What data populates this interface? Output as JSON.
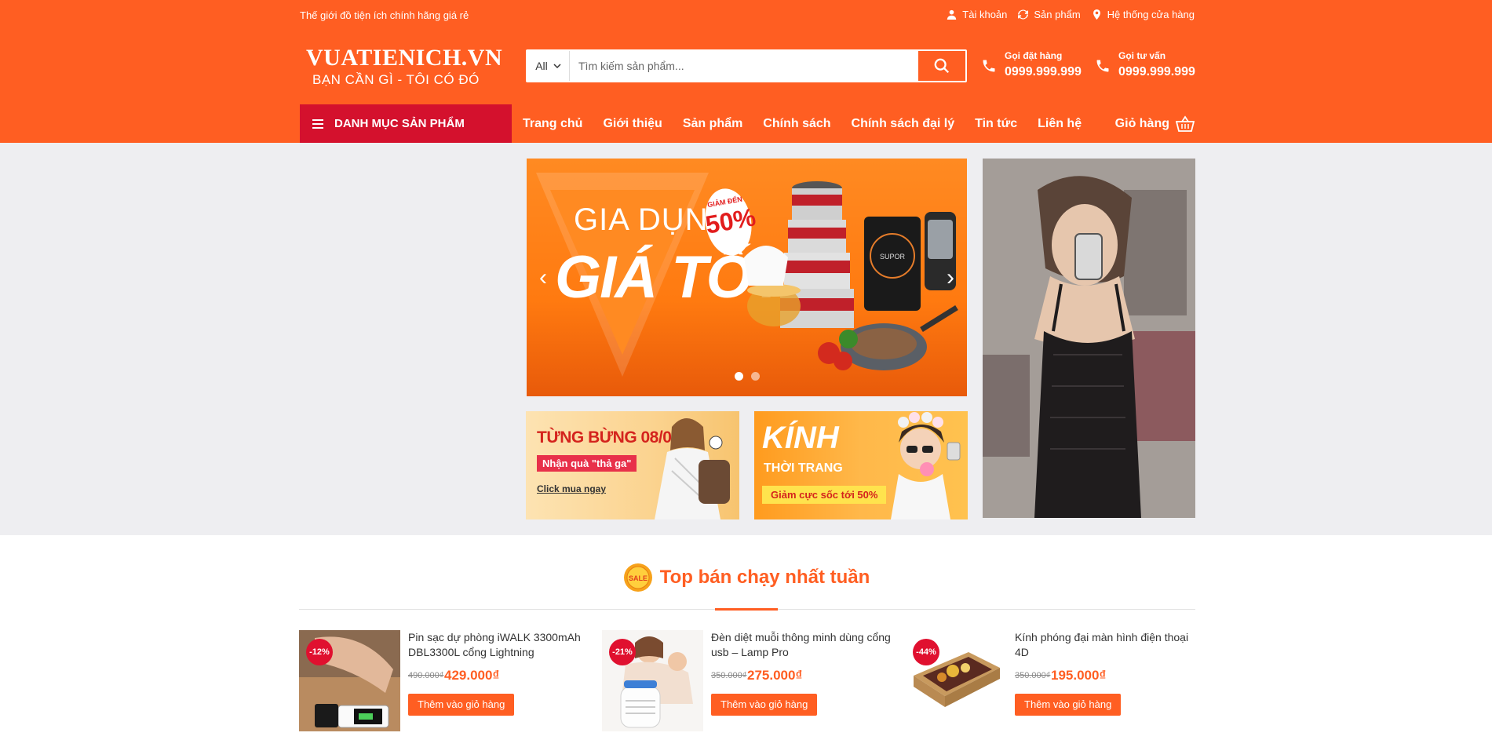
{
  "topbar": {
    "tagline": "Thế giới đồ tiện ích chính hãng giá rẻ",
    "links": [
      {
        "icon": "user-icon",
        "label": "Tài khoản"
      },
      {
        "icon": "refresh-icon",
        "label": "Sản phẩm"
      },
      {
        "icon": "map-pin-icon",
        "label": "Hệ thống cửa hàng"
      }
    ]
  },
  "logo": {
    "brand": "VUATIENICH.VN",
    "slogan": "BẠN CẦN GÌ - TÔI CÓ ĐÓ"
  },
  "search": {
    "category": "All",
    "placeholder": "Tìm kiếm sản phẩm..."
  },
  "hotlines": [
    {
      "label": "Gọi đặt hàng",
      "number": "0999.999.999"
    },
    {
      "label": "Gọi tư vấn",
      "number": "0999.999.999"
    }
  ],
  "nav": {
    "category_menu": "DANH MỤC SẢN PHẨM",
    "links": [
      "Trang chủ",
      "Giới thiệu",
      "Sản phẩm",
      "Chính sách",
      "Chính sách đại lý",
      "Tin tức",
      "Liên hệ"
    ],
    "cart": "Giỏ hàng"
  },
  "slider": {
    "line1": "GIA DỤNG",
    "line2": "GIÁ TỐT",
    "badge_small": "GIẢM ĐẾN",
    "badge_big": "50%",
    "brand_on_cooker": "SUPOR",
    "slides_total": 2,
    "active_slide": 1
  },
  "banners": {
    "b1": {
      "headline": "TỪNG BỪNG 08/03",
      "tag": "Nhận quà \"thả ga\"",
      "link": "Click mua ngay"
    },
    "b2": {
      "headline": "KÍNH",
      "sub": "THỜI TRANG",
      "tag": "Giảm cực sốc tới 50%"
    }
  },
  "section": {
    "title": "Top bán chạy nhất tuần",
    "badge_text": "SALE"
  },
  "products": [
    {
      "discount": "-12%",
      "name": "Pin sạc dự phòng iWALK 3300mAh DBL3300L cổng Lightning",
      "old_price": "490.000₫",
      "price": "429.000₫",
      "button": "Thêm vào giỏ hàng"
    },
    {
      "discount": "-21%",
      "name": "Đèn diệt muỗi thông minh dùng cổng usb – Lamp Pro",
      "old_price": "350.000₫",
      "price": "275.000₫",
      "button": "Thêm vào giỏ hàng"
    },
    {
      "discount": "-44%",
      "name": "Kính phóng đại màn hình điện thoại 4D",
      "old_price": "350.000₫",
      "price": "195.000₫",
      "button": "Thêm vào giỏ hàng"
    }
  ],
  "colors": {
    "primary": "#ff5e22",
    "category_menu_bg": "#d4112d",
    "discount_badge": "#e0102f",
    "hero_bg": "#eeeef1"
  }
}
